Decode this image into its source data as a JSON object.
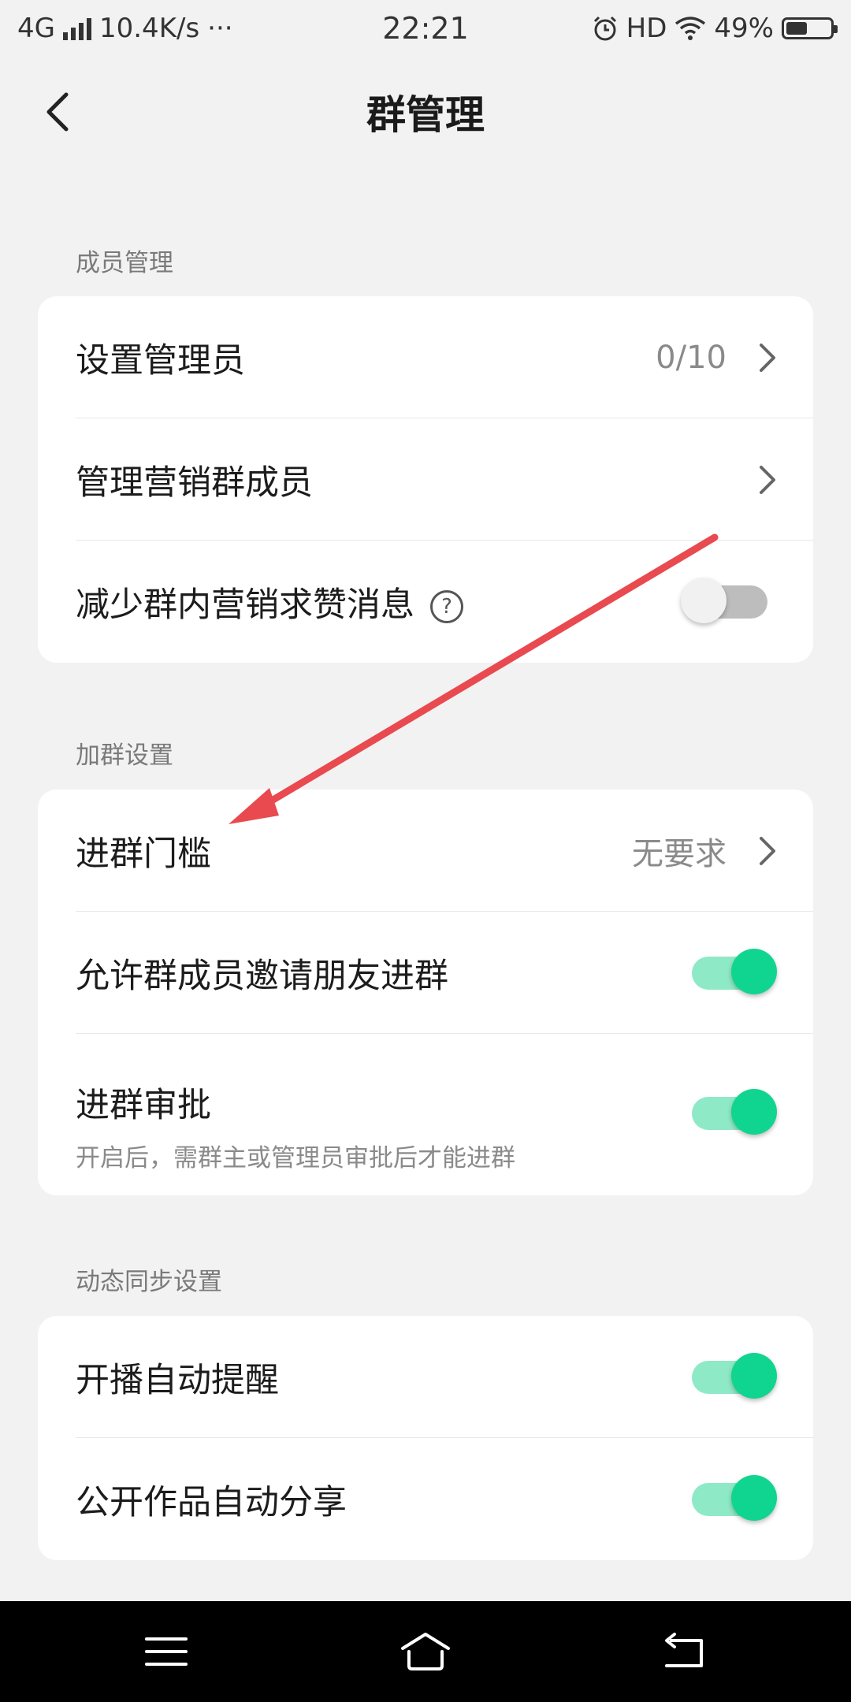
{
  "status_bar": {
    "network": "4G",
    "speed": "10.4K/s",
    "more": "···",
    "time": "22:21",
    "hd": "HD",
    "battery": "49%",
    "battery_level": 0.49
  },
  "header": {
    "title": "群管理"
  },
  "sections": [
    {
      "title": "成员管理",
      "rows": [
        {
          "label": "设置管理员",
          "value": "0/10"
        },
        {
          "label": "管理营销群成员",
          "value": ""
        },
        {
          "label": "减少群内营销求赞消息",
          "help": "?",
          "toggle": false
        }
      ]
    },
    {
      "title": "加群设置",
      "rows": [
        {
          "label": "进群门槛",
          "value": "无要求"
        },
        {
          "label": "允许群成员邀请朋友进群",
          "toggle": true
        },
        {
          "label": "进群审批",
          "description": "开启后，需群主或管理员审批后才能进群",
          "toggle": true
        }
      ]
    },
    {
      "title": "动态同步设置",
      "rows": [
        {
          "label": "开播自动提醒",
          "toggle": true
        },
        {
          "label": "公开作品自动分享",
          "toggle": true
        }
      ]
    }
  ],
  "annotation_arrow_color": "#e84a4f",
  "accent_color": "#10d590",
  "icons": [
    "back-icon",
    "chevron-right-icon",
    "help-icon",
    "menu-icon",
    "home-icon",
    "return-icon",
    "alarm-icon",
    "wifi-icon",
    "battery-icon"
  ]
}
